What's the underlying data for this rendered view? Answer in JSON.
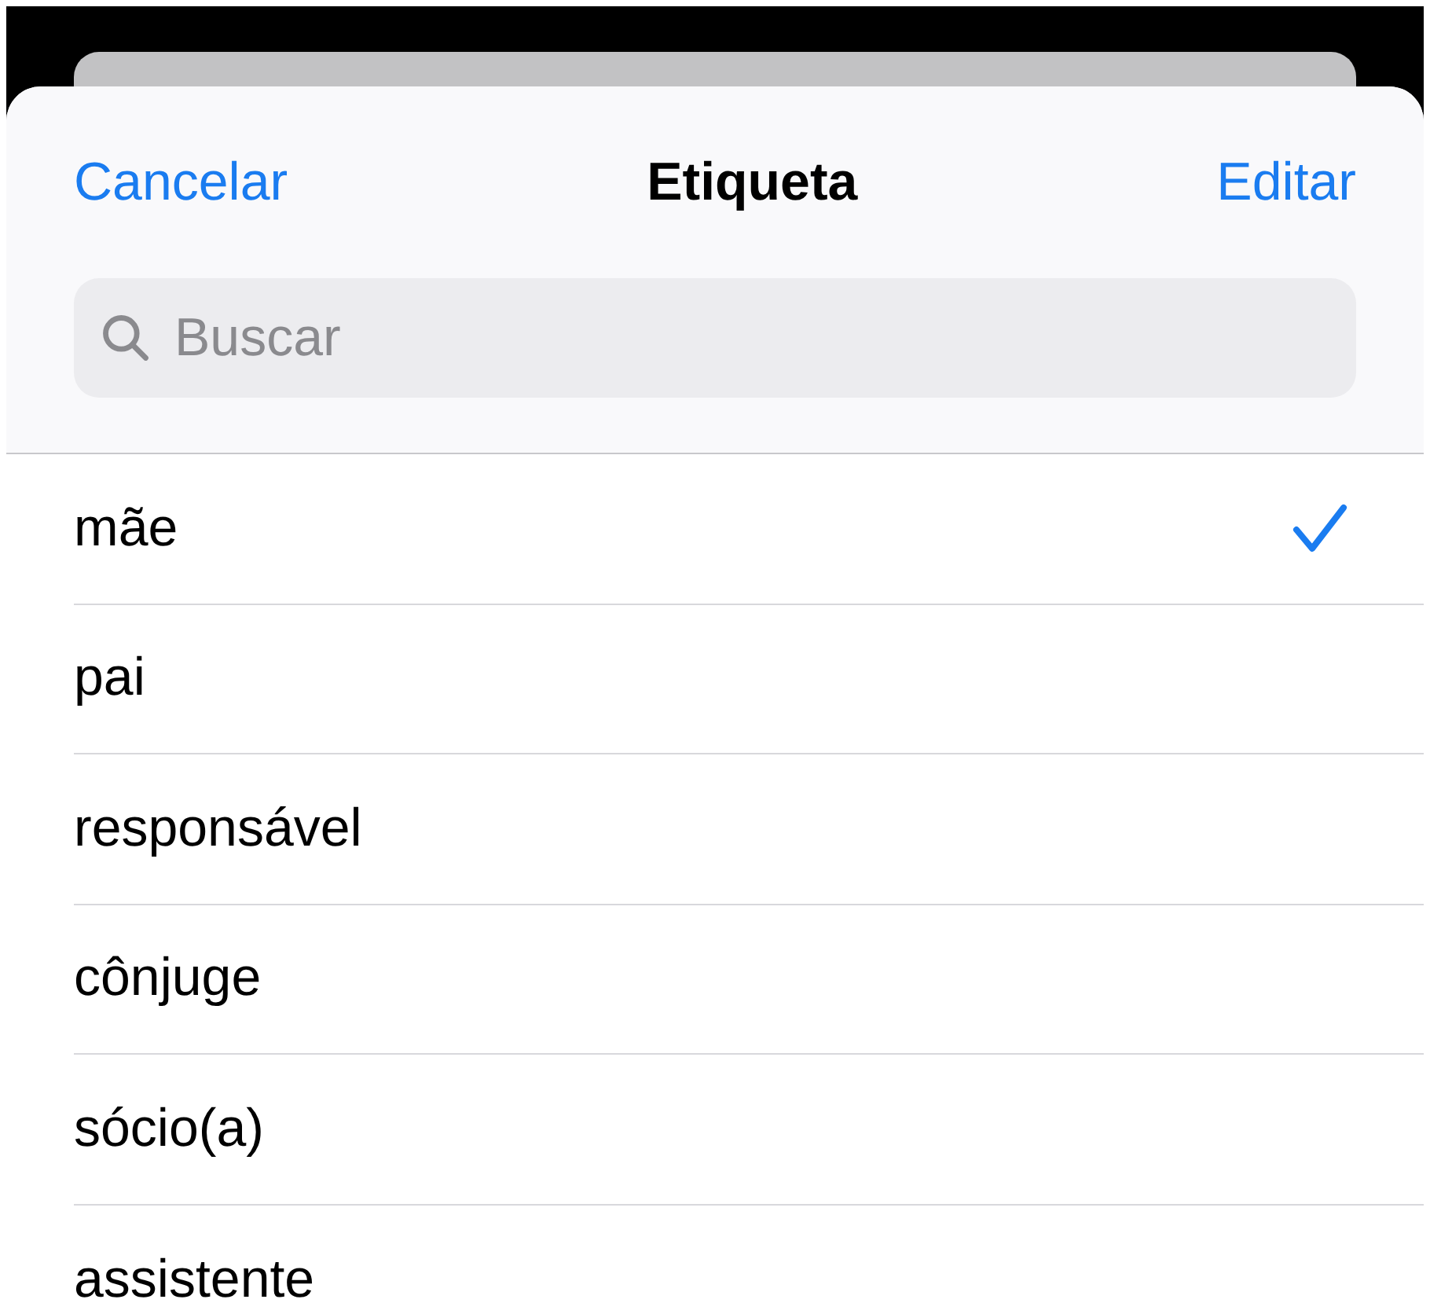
{
  "navigation": {
    "cancel": "Cancelar",
    "title": "Etiqueta",
    "edit": "Editar"
  },
  "search": {
    "placeholder": "Buscar"
  },
  "labels": [
    {
      "text": "mãe",
      "selected": true
    },
    {
      "text": "pai",
      "selected": false
    },
    {
      "text": "responsável",
      "selected": false
    },
    {
      "text": "cônjuge",
      "selected": false
    },
    {
      "text": "sócio(a)",
      "selected": false
    },
    {
      "text": "assistente",
      "selected": false
    }
  ]
}
